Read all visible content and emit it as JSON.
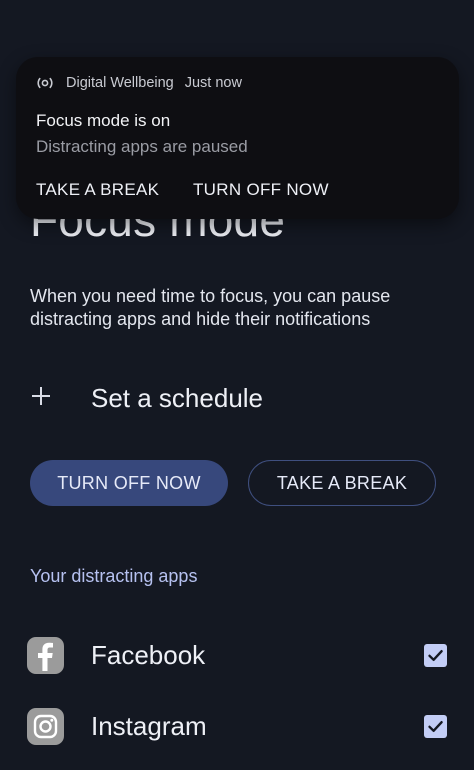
{
  "page": {
    "title": "Focus mode",
    "description": "When you need time to focus, you can pause distracting apps and hide their notifications",
    "schedule_label": "Set a schedule",
    "turn_off_label": "TURN OFF NOW",
    "take_break_label": "TAKE A BREAK",
    "section_header": "Your distracting apps",
    "apps": [
      {
        "name": "Facebook",
        "icon": "facebook-icon",
        "checked": true
      },
      {
        "name": "Instagram",
        "icon": "instagram-icon",
        "checked": true
      }
    ]
  },
  "notification": {
    "app_name": "Digital Wellbeing",
    "time": "Just now",
    "title": "Focus mode is on",
    "body": "Distracting apps are paused",
    "actions": [
      "TAKE A BREAK",
      "TURN OFF NOW"
    ]
  },
  "colors": {
    "background": "#141822",
    "primary_button": "#37487c",
    "accent_text": "#b6c1f0",
    "checkbox": "#c3cdf6",
    "notification_bg": "#0e0e12"
  }
}
